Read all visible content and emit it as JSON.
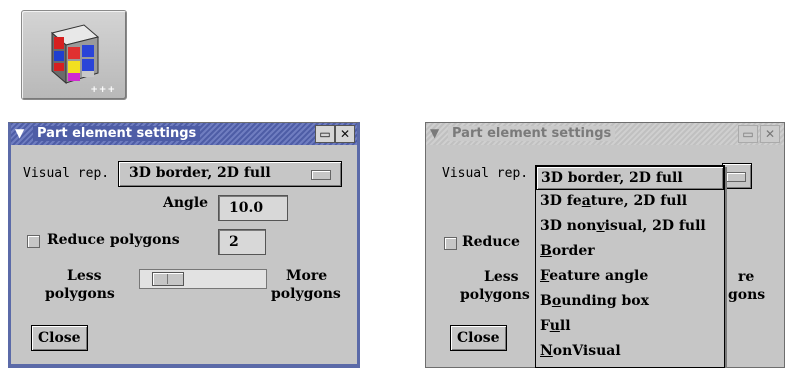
{
  "left_dialog": {
    "title": "Part element settings",
    "visual_rep_label": "Visual rep.",
    "visual_rep_value": "3D border, 2D full",
    "angle_label": "Angle",
    "angle_value": "10.0",
    "reduce_label": "Reduce polygons",
    "reduce_value": "2",
    "reduce_checked": false,
    "slider_left_line1": "Less",
    "slider_left_line2": "polygons",
    "slider_right_line1": "More",
    "slider_right_line2": "polygons",
    "close_label": "Close"
  },
  "right_dialog": {
    "title": "Part element settings",
    "visual_rep_label": "Visual rep.",
    "reduce_label_partial": "Reduce",
    "slider_left_line1": "Less",
    "slider_left_line2": "polygons",
    "slider_right_line1_partial": "re",
    "slider_right_line2_partial": "gons",
    "close_label": "Close",
    "menu_options": [
      {
        "pre": "",
        "ul": "",
        "post": "3D border, 2D full"
      },
      {
        "pre": "3D fe",
        "ul": "a",
        "post": "ture, 2D full"
      },
      {
        "pre": "3D non",
        "ul": "v",
        "post": "isual, 2D full"
      },
      {
        "pre": "",
        "ul": "B",
        "post": "order"
      },
      {
        "pre": "",
        "ul": "F",
        "post": "eature angle"
      },
      {
        "pre": "B",
        "ul": "o",
        "post": "unding box"
      },
      {
        "pre": "F",
        "ul": "u",
        "post": "ll"
      },
      {
        "pre": "",
        "ul": "N",
        "post": "onVisual"
      }
    ]
  },
  "colors": {
    "titlebar_active": "#4e5da6",
    "dialog_bg": "#c6c6c6"
  },
  "icons": {
    "tool_icon": "part-settings-cube-icon",
    "window_menu": "chevron-down-icon",
    "maximize": "maximize-icon",
    "close": "close-icon"
  }
}
